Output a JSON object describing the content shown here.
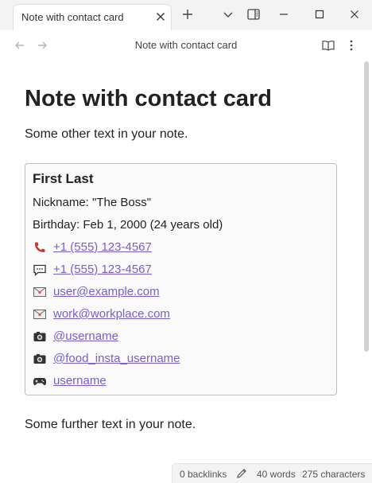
{
  "tab": {
    "title": "Note with contact card"
  },
  "nav": {
    "title": "Note with contact card"
  },
  "note": {
    "title": "Note with contact card",
    "intro": "Some other text in your note.",
    "outro": "Some further text in your note.",
    "card": {
      "name": "First Last",
      "nickname": "Nickname: \"The Boss\"",
      "birthday": "Birthday: Feb 1, 2000 (24 years old)",
      "entries": [
        {
          "icon": "phone-icon",
          "text": "+1 (555) 123-4567"
        },
        {
          "icon": "message-icon",
          "text": "+1 (555) 123-4567"
        },
        {
          "icon": "envelope-icon",
          "text": "user@example.com"
        },
        {
          "icon": "envelope-icon",
          "text": "work@workplace.com"
        },
        {
          "icon": "camera-icon",
          "text": "@username"
        },
        {
          "icon": "camera-icon",
          "text": "@food_insta_username"
        },
        {
          "icon": "gamepad-icon",
          "text": "username"
        }
      ]
    }
  },
  "status": {
    "backlinks": "0 backlinks",
    "words": "40 words",
    "characters": "275 characters"
  },
  "colors": {
    "link": "#7a5cd6",
    "phone": "#c0392b"
  }
}
